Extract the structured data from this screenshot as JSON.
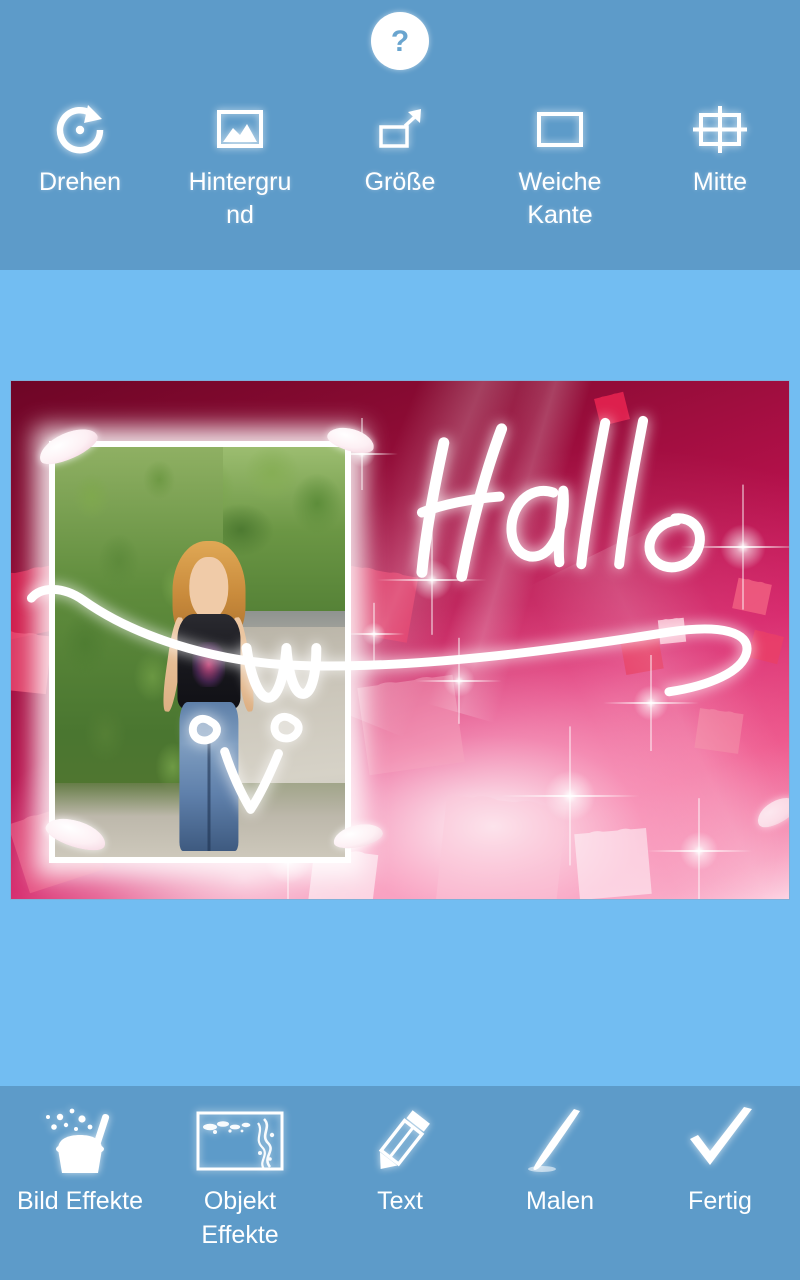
{
  "app": {
    "theme": {
      "toolbar_blue": "#5d9bc9",
      "canvas_blue": "#72bdf2",
      "icon_white": "#ffffff",
      "collage_dark_red": "#7e0a2c",
      "collage_pink": "#e8487f"
    }
  },
  "top_bar": {
    "help_button": {
      "name": "help-button",
      "icon": "question-mark-icon",
      "glyph": "?"
    },
    "tools": [
      {
        "label": "Drehen",
        "icon": "rotate-clockwise-icon"
      },
      {
        "label": "Hintergrund",
        "icon": "image-landscape-icon"
      },
      {
        "label": "Größe",
        "icon": "resize-arrow-icon"
      },
      {
        "label": "Weiche Kante",
        "icon": "soft-edge-rectangle-icon"
      },
      {
        "label": "Mitte",
        "icon": "center-crosshair-icon"
      }
    ]
  },
  "canvas": {
    "name": "collage-artboard",
    "overlay_text": "Hallo",
    "description": "Pink and red hearts collage with a framed outdoor photo of a woman standing on a gravel path beside green bushes, plus white handwritten script and a hand-drawn smiley underline.",
    "photo": {
      "name": "embedded-photo",
      "subject": "woman in black tank top and blue jeans",
      "scene": "gravel road, green hedge, trees"
    },
    "decorations": [
      "heart-shape",
      "sparkle-star",
      "light-beam",
      "white-petal"
    ]
  },
  "bottom_bar": {
    "tools": [
      {
        "label": "Bild Effekte",
        "icon": "magic-hat-wand-icon"
      },
      {
        "label": "Objekt Effekte",
        "icon": "ornate-frame-icon"
      },
      {
        "label": "Text",
        "icon": "pencil-icon"
      },
      {
        "label": "Malen",
        "icon": "brush-stroke-icon"
      },
      {
        "label": "Fertig",
        "icon": "checkmark-icon"
      }
    ]
  }
}
